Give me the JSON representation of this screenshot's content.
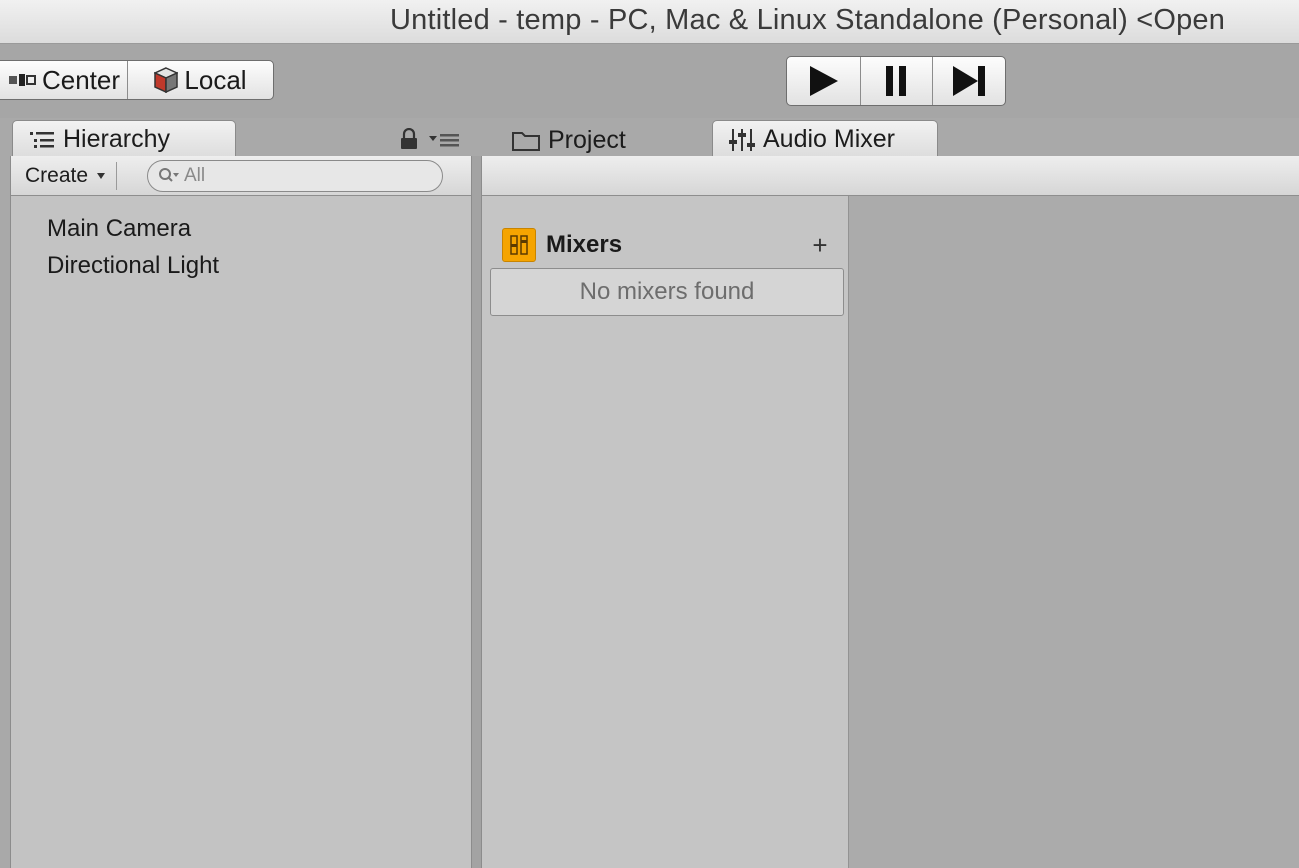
{
  "window": {
    "title": "Untitled - temp - PC, Mac & Linux Standalone (Personal) <Open"
  },
  "toolbar": {
    "pivot_center_label": "Center",
    "pivot_local_label": "Local",
    "play_icon": "play-icon",
    "pause_icon": "pause-icon",
    "step_icon": "step-icon"
  },
  "tabs": {
    "hierarchy": "Hierarchy",
    "project": "Project",
    "audio_mixer": "Audio Mixer"
  },
  "hierarchy": {
    "create_label": "Create",
    "search_placeholder": "All",
    "items": [
      {
        "label": "Main Camera"
      },
      {
        "label": "Directional Light"
      }
    ]
  },
  "audio_mixer": {
    "section_title": "Mixers",
    "add_label": "+",
    "empty_text": "No mixers found",
    "accent": "#f5a400"
  }
}
